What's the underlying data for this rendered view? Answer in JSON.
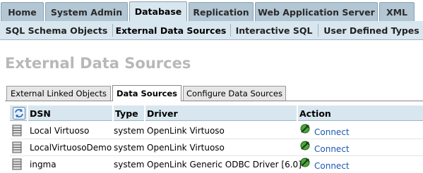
{
  "top_tabs": [
    "Home",
    "System Admin",
    "Database",
    "Replication",
    "Web Application Server",
    "XML"
  ],
  "sub_tabs": [
    "SQL Schema Objects",
    "External Data Sources",
    "Interactive SQL",
    "User Defined Types"
  ],
  "page_title": "External Data Sources",
  "inner_tabs": [
    "External Linked Objects",
    "Data Sources",
    "Configure Data Sources"
  ],
  "table": {
    "columns": [
      "DSN",
      "Type",
      "Driver",
      "Action"
    ],
    "rows": [
      {
        "dsn": "Local Virtuoso",
        "type": "system",
        "driver": "OpenLink Virtuoso",
        "action": "Connect"
      },
      {
        "dsn": "LocalVirtuosoDemo",
        "type": "system",
        "driver": "OpenLink Virtuoso",
        "action": "Connect"
      },
      {
        "dsn": "ingma",
        "type": "system",
        "driver": "OpenLink Generic ODBC Driver [6.0]",
        "action": "Connect"
      }
    ]
  },
  "colors": {
    "tab_bg": "#b3c6d4",
    "active_bg": "#d8e6ef",
    "link": "#1b57b5",
    "title": "#b8b8b8"
  },
  "icons": {
    "refresh": "refresh-icon",
    "database": "database-icon",
    "connect": "connect-plug-icon"
  }
}
